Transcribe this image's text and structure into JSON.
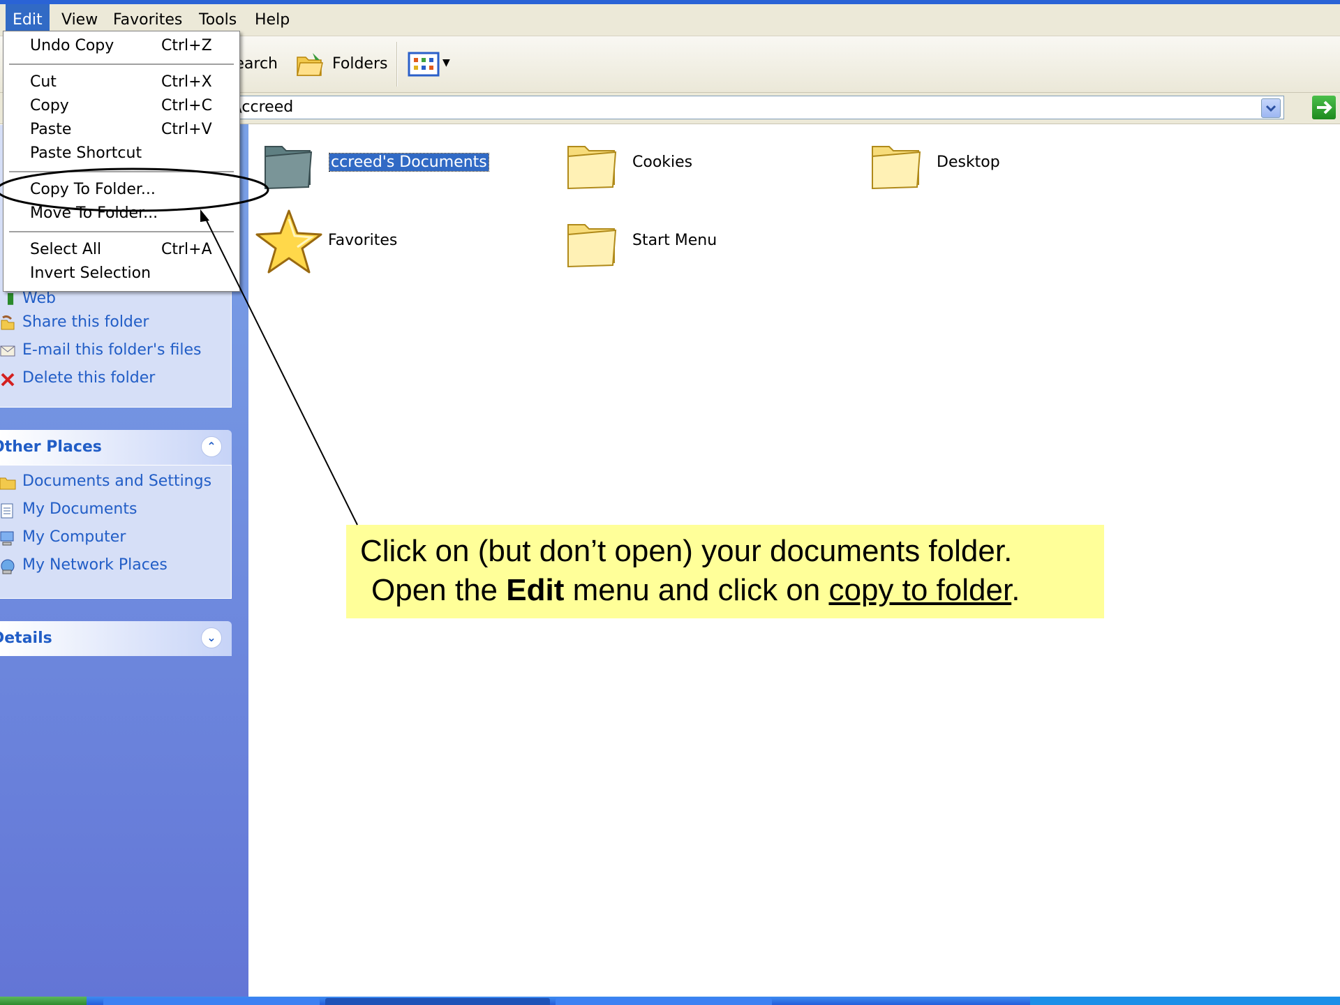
{
  "menubar": {
    "items": [
      "Edit",
      "View",
      "Favorites",
      "Tools",
      "Help"
    ]
  },
  "toolbar": {
    "search_label": "Search",
    "folders_label": "Folders"
  },
  "address": {
    "value": "\\ccreed"
  },
  "edit_menu": {
    "items": [
      {
        "label": "Undo Copy",
        "shortcut": "Ctrl+Z"
      },
      {
        "label": "Cut",
        "shortcut": "Ctrl+X"
      },
      {
        "label": "Copy",
        "shortcut": "Ctrl+C"
      },
      {
        "label": "Paste",
        "shortcut": "Ctrl+V"
      },
      {
        "label": "Paste Shortcut",
        "shortcut": ""
      },
      {
        "label": "Copy To Folder...",
        "shortcut": ""
      },
      {
        "label": "Move To Folder...",
        "shortcut": ""
      },
      {
        "label": "Select All",
        "shortcut": "Ctrl+A"
      },
      {
        "label": "Invert Selection",
        "shortcut": ""
      }
    ]
  },
  "task_pane": {
    "folder_tasks": {
      "items": [
        {
          "label": "Web",
          "icon": "web-icon"
        },
        {
          "label": "Share this folder",
          "icon": "share-icon"
        },
        {
          "label": "E-mail this folder's files",
          "icon": "email-icon"
        },
        {
          "label": "Delete this folder",
          "icon": "delete-icon"
        }
      ]
    },
    "other_places": {
      "title": "Other Places",
      "items": [
        {
          "label": "Documents and Settings",
          "icon": "folder-icon"
        },
        {
          "label": "My Documents",
          "icon": "documents-icon"
        },
        {
          "label": "My Computer",
          "icon": "computer-icon"
        },
        {
          "label": "My Network Places",
          "icon": "network-icon"
        }
      ]
    },
    "details": {
      "title": "Details"
    }
  },
  "content": {
    "items": [
      {
        "label": "ccreed's Documents",
        "selected": true,
        "icon": "documents-folder-icon"
      },
      {
        "label": "Cookies",
        "selected": false,
        "icon": "folder-icon"
      },
      {
        "label": "Desktop",
        "selected": false,
        "icon": "folder-icon"
      },
      {
        "label": "Favorites",
        "selected": false,
        "icon": "star-icon"
      },
      {
        "label": "Start Menu",
        "selected": false,
        "icon": "folder-icon"
      }
    ]
  },
  "callout": {
    "line1": "Click on (but don’t open) your documents folder.",
    "line2_prefix": "Open the ",
    "line2_bold": "Edit",
    "line2_mid": " menu and click on ",
    "line2_link": "copy to folder",
    "line2_suffix": "."
  },
  "colors": {
    "selection": "#316ac5",
    "callout_bg": "#ffff99",
    "taskpane_link": "#215dc6",
    "taskpane_bg": "#6375d6"
  }
}
